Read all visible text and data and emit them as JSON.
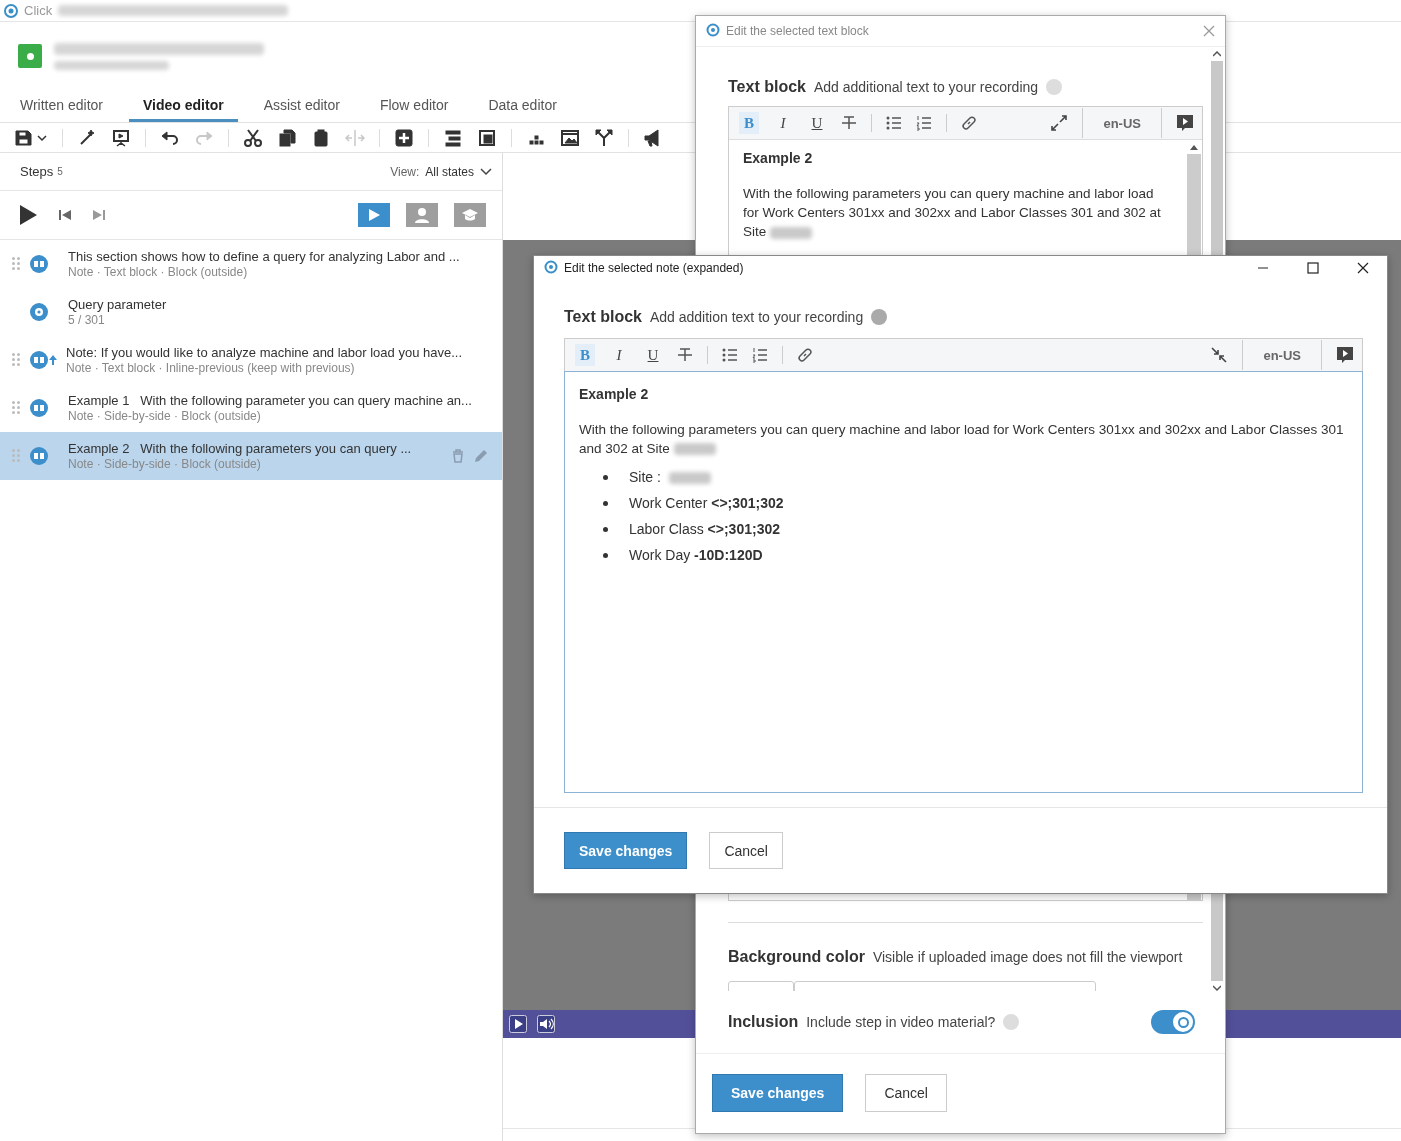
{
  "app_title": "Click",
  "tabs": [
    {
      "label": "Written editor",
      "selected": false
    },
    {
      "label": "Video editor",
      "selected": true
    },
    {
      "label": "Assist editor",
      "selected": false
    },
    {
      "label": "Flow editor",
      "selected": false
    },
    {
      "label": "Data editor",
      "selected": false
    }
  ],
  "toolbar": [
    {
      "kind": "save",
      "disabled": false
    },
    {
      "kind": "magic",
      "disabled": false
    },
    {
      "kind": "present",
      "disabled": false
    },
    {
      "kind": "undo",
      "disabled": false
    },
    {
      "kind": "redo",
      "disabled": true
    },
    {
      "kind": "cut",
      "disabled": false
    },
    {
      "kind": "copy",
      "disabled": false
    },
    {
      "kind": "paste",
      "disabled": false
    },
    {
      "kind": "move",
      "disabled": true
    },
    {
      "kind": "add",
      "disabled": false
    },
    {
      "kind": "rows",
      "disabled": false
    },
    {
      "kind": "frame",
      "disabled": false
    },
    {
      "kind": "dots",
      "disabled": false
    },
    {
      "kind": "image",
      "disabled": false
    },
    {
      "kind": "branch",
      "disabled": false
    },
    {
      "kind": "megaphone",
      "disabled": false
    }
  ],
  "steps_panel": {
    "title": "Steps",
    "count": "5",
    "view_label": "View:",
    "view_value": "All states"
  },
  "mode_buttons": [
    {
      "kind": "video",
      "selected": true
    },
    {
      "kind": "person",
      "selected": false
    },
    {
      "kind": "learn",
      "selected": false
    }
  ],
  "steps": [
    {
      "kind": "note",
      "inline": false,
      "title": "This section shows how to define a query for analyzing Labor and ...",
      "subtitle": "Note · Text block · Block (outside)",
      "selected": false
    },
    {
      "kind": "screen",
      "inline": false,
      "title": "Query parameter",
      "subtitle": "5 / 301",
      "selected": false
    },
    {
      "kind": "note",
      "inline": true,
      "title": "Note: If you would like to analyze machine and labor load you have...",
      "subtitle": "Note · Text block · Inline-previous (keep with previous)",
      "selected": false
    },
    {
      "kind": "note",
      "inline": false,
      "label": "Example 1",
      "title": "With the following parameter you can query machine an...",
      "subtitle": "Note · Side-by-side · Block (outside)",
      "selected": false
    },
    {
      "kind": "note",
      "inline": false,
      "label": "Example 2",
      "title": "With the following parameters you can query ...",
      "subtitle": "Note · Side-by-side · Block (outside)",
      "selected": true
    }
  ],
  "back_dialog": {
    "title": "Edit the selected text block",
    "section_title": "Text block",
    "section_hint": "Add additional text to your recording",
    "format_buttons": [
      {
        "kind": "bold",
        "label": "B",
        "selected": true
      },
      {
        "kind": "italic",
        "label": "I",
        "selected": false
      },
      {
        "kind": "underline",
        "label": "U",
        "selected": false
      }
    ],
    "language": "en-US",
    "heading": "Example 2",
    "body": "With the following parameters you can query machine and labor load for Work Centers 301xx and 302xx and Labor Classes 301 and 302 at Site",
    "background_title": "Background color",
    "background_hint": "Visible if uploaded image does not fill the viewport",
    "inclusion_title": "Inclusion",
    "inclusion_hint": "Include step in video material?",
    "include_on": true,
    "save_label": "Save changes",
    "cancel_label": "Cancel"
  },
  "front_dialog": {
    "title": "Edit the selected note (expanded)",
    "section_title": "Text block",
    "section_hint": "Add addition text to your recording",
    "format_buttons": [
      {
        "kind": "bold",
        "label": "B",
        "selected": true
      },
      {
        "kind": "italic",
        "label": "I",
        "selected": false
      },
      {
        "kind": "underline",
        "label": "U",
        "selected": false
      }
    ],
    "language": "en-US",
    "heading": "Example 2",
    "body": "With the following parameters you can query machine and labor load for Work Centers 301xx and 302xx and Labor Classes 301 and 302 at Site",
    "bullets": [
      {
        "text": "Site :",
        "redacted": true
      },
      {
        "text": "Work Center **<>;301;302**",
        "redacted": false
      },
      {
        "text": "Labor Class **<>;301;302**",
        "redacted": false
      },
      {
        "text": "Work Day **-10D:120D**",
        "redacted": false
      }
    ],
    "save_label": "Save changes",
    "cancel_label": "Cancel"
  }
}
